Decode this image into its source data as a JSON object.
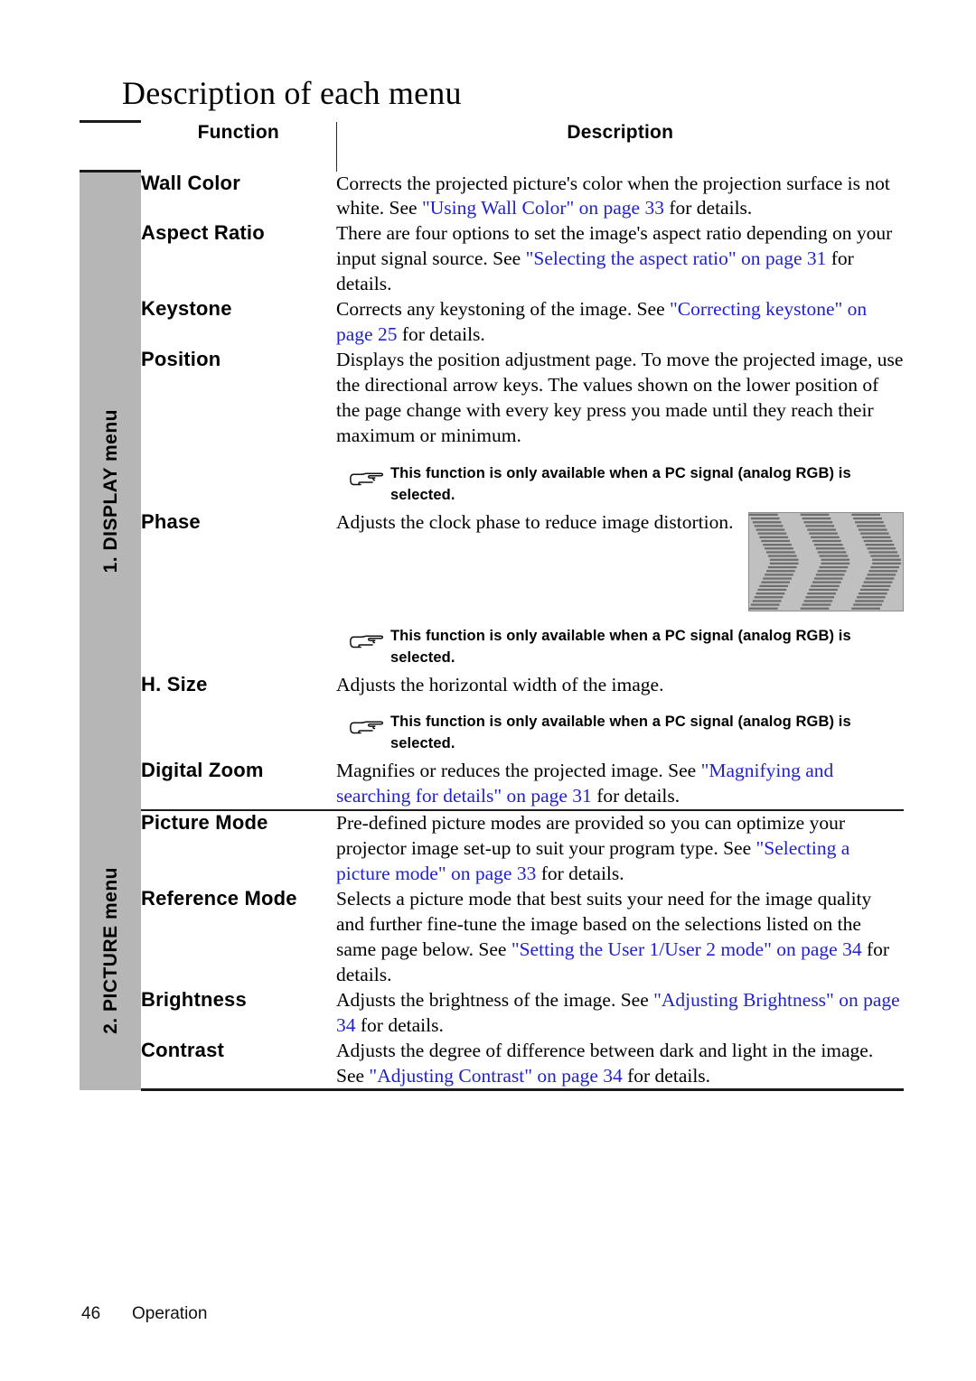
{
  "document": {
    "title": "Description of each menu"
  },
  "table": {
    "headers": {
      "function": "Function",
      "description": "Description"
    },
    "sections": [
      {
        "label": "1. DISPLAY menu",
        "rows": [
          {
            "function": "Wall Color",
            "description_parts": [
              {
                "text": "Corrects the projected picture's color when the projection surface is not white. See ",
                "link": false
              },
              {
                "text": "\"Using Wall Color\" on page 33",
                "link": true
              },
              {
                "text": " for details.",
                "link": false
              }
            ],
            "note": null,
            "image": null
          },
          {
            "function": "Aspect Ratio",
            "description_parts": [
              {
                "text": "There are four options to set the image's aspect ratio depending on your input signal source. See ",
                "link": false
              },
              {
                "text": "\"Selecting the aspect ratio\" on page 31",
                "link": true
              },
              {
                "text": " for details.",
                "link": false
              }
            ],
            "note": null,
            "image": null
          },
          {
            "function": "Keystone",
            "description_parts": [
              {
                "text": "Corrects any keystoning of the image. See ",
                "link": false
              },
              {
                "text": "\"Correcting keystone\" on page 25",
                "link": true
              },
              {
                "text": " for details.",
                "link": false
              }
            ],
            "note": null,
            "image": null
          },
          {
            "function": "Position",
            "description_parts": [
              {
                "text": "Displays the position adjustment page. To move the projected image, use the directional arrow keys. The values shown on the lower position of the page change with every key press you made until they reach their maximum or minimum.",
                "link": false
              }
            ],
            "note": "This function is only available when a PC signal (analog RGB) is selected.",
            "image": null
          },
          {
            "function": "Phase",
            "description_parts": [
              {
                "text": "Adjusts the clock phase to reduce image distortion.",
                "link": false
              }
            ],
            "note": "This function is only available when a PC signal (analog RGB) is selected.",
            "image": "phase-distortion-sample"
          },
          {
            "function": "H. Size",
            "description_parts": [
              {
                "text": "Adjusts the horizontal width of the image.",
                "link": false
              }
            ],
            "note": "This function is only available when a PC signal (analog RGB) is selected.",
            "image": null
          },
          {
            "function": "Digital Zoom",
            "description_parts": [
              {
                "text": "Magnifies or reduces the projected image. See ",
                "link": false
              },
              {
                "text": "\"Magnifying and searching for details\" on page 31",
                "link": true
              },
              {
                "text": " for details.",
                "link": false
              }
            ],
            "note": null,
            "image": null
          }
        ]
      },
      {
        "label": "2. PICTURE menu",
        "rows": [
          {
            "function": "Picture Mode",
            "description_parts": [
              {
                "text": "Pre-defined picture modes are provided so you can optimize your projector image set-up to suit your program type. See ",
                "link": false
              },
              {
                "text": "\"Selecting a picture mode\" on page 33",
                "link": true
              },
              {
                "text": " for details.",
                "link": false
              }
            ],
            "note": null,
            "image": null
          },
          {
            "function": "Reference Mode",
            "description_parts": [
              {
                "text": "Selects a picture mode that best suits your need for the image quality and further fine-tune the image based on the selections listed on the same page below. See ",
                "link": false
              },
              {
                "text": "\"Setting the User 1/User 2 mode\" on page 34",
                "link": true
              },
              {
                "text": " for details.",
                "link": false
              }
            ],
            "note": null,
            "image": null
          },
          {
            "function": "Brightness",
            "description_parts": [
              {
                "text": "Adjusts the brightness of the image. See ",
                "link": false
              },
              {
                "text": "\"Adjusting Brightness\" on page 34",
                "link": true
              },
              {
                "text": " for details.",
                "link": false
              }
            ],
            "note": null,
            "image": null
          },
          {
            "function": "Contrast",
            "description_parts": [
              {
                "text": "Adjusts the degree of difference between dark and light in the image. See ",
                "link": false
              },
              {
                "text": "\"Adjusting Contrast\" on page 34",
                "link": true
              },
              {
                "text": " for details.",
                "link": false
              }
            ],
            "note": null,
            "image": null
          }
        ]
      }
    ]
  },
  "footer": {
    "page_number": "46",
    "chapter": "Operation"
  },
  "icons": {
    "note": "pointing-hand-icon"
  },
  "colors": {
    "link": "#2222cc",
    "side_band": "#b6b6b6",
    "rule": "#1a1a1a",
    "sample_bg": "#c0c0c0",
    "sample_stripe": "#6e6e6e"
  }
}
